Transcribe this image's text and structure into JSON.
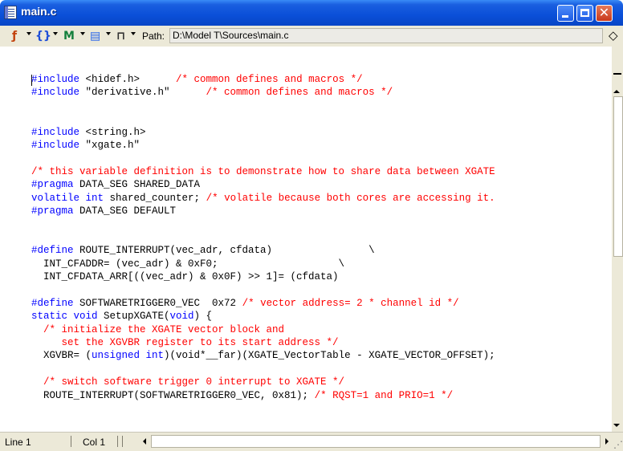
{
  "window": {
    "title": "main.c"
  },
  "toolbar": {
    "path_label": "Path:",
    "path_value": "D:\\Model T\\Sources\\main.c",
    "icons": [
      "function-icon",
      "braces-icon",
      "marker-icon",
      "document-icon",
      "lock-icon"
    ]
  },
  "code_lines": [
    {
      "row": 0,
      "segments": [
        {
          "cls": "pp",
          "text": "#include "
        },
        {
          "cls": "tx",
          "text": "<hidef.h>      "
        },
        {
          "cls": "cm",
          "text": "/* common defines and macros */"
        }
      ]
    },
    {
      "row": 1,
      "segments": [
        {
          "cls": "pp",
          "text": "#include "
        },
        {
          "cls": "tx",
          "text": "\"derivative.h\"      "
        },
        {
          "cls": "cm",
          "text": "/* common defines and macros */"
        }
      ]
    },
    {
      "row": 4,
      "segments": [
        {
          "cls": "pp",
          "text": "#include "
        },
        {
          "cls": "tx",
          "text": "<string.h>"
        }
      ]
    },
    {
      "row": 5,
      "segments": [
        {
          "cls": "pp",
          "text": "#include "
        },
        {
          "cls": "tx",
          "text": "\"xgate.h\""
        }
      ]
    },
    {
      "row": 7,
      "segments": [
        {
          "cls": "cm",
          "text": "/* this variable definition is to demonstrate how to share data between XGATE"
        }
      ]
    },
    {
      "row": 8,
      "segments": [
        {
          "cls": "pp",
          "text": "#pragma "
        },
        {
          "cls": "tx",
          "text": "DATA_SEG SHARED_DATA"
        }
      ]
    },
    {
      "row": 9,
      "segments": [
        {
          "cls": "kw",
          "text": "volatile int "
        },
        {
          "cls": "tx",
          "text": "shared_counter; "
        },
        {
          "cls": "cm",
          "text": "/* volatile because both cores are accessing it."
        }
      ]
    },
    {
      "row": 10,
      "segments": [
        {
          "cls": "pp",
          "text": "#pragma "
        },
        {
          "cls": "tx",
          "text": "DATA_SEG DEFAULT"
        }
      ]
    },
    {
      "row": 13,
      "segments": [
        {
          "cls": "pp",
          "text": "#define "
        },
        {
          "cls": "tx",
          "text": "ROUTE_INTERRUPT(vec_adr, cfdata)                \\"
        }
      ]
    },
    {
      "row": 14,
      "segments": [
        {
          "cls": "tx",
          "text": "  INT_CFADDR= (vec_adr) & 0xF0;                    \\"
        }
      ]
    },
    {
      "row": 15,
      "segments": [
        {
          "cls": "tx",
          "text": "  INT_CFDATA_ARR[((vec_adr) & 0x0F) >> 1]= (cfdata)"
        }
      ]
    },
    {
      "row": 17,
      "segments": [
        {
          "cls": "pp",
          "text": "#define "
        },
        {
          "cls": "tx",
          "text": "SOFTWARETRIGGER0_VEC  0x72 "
        },
        {
          "cls": "cm",
          "text": "/* vector address= 2 * channel id */"
        }
      ]
    },
    {
      "row": 18,
      "segments": [
        {
          "cls": "kw",
          "text": "static void "
        },
        {
          "cls": "tx",
          "text": "SetupXGATE("
        },
        {
          "cls": "kw",
          "text": "void"
        },
        {
          "cls": "tx",
          "text": ") {"
        }
      ]
    },
    {
      "row": 19,
      "segments": [
        {
          "cls": "cm",
          "text": "  /* initialize the XGATE vector block and"
        }
      ]
    },
    {
      "row": 20,
      "segments": [
        {
          "cls": "cm",
          "text": "     set the XGVBR register to its start address */"
        }
      ]
    },
    {
      "row": 21,
      "segments": [
        {
          "cls": "tx",
          "text": "  XGVBR= ("
        },
        {
          "cls": "kw",
          "text": "unsigned int"
        },
        {
          "cls": "tx",
          "text": ")(void*__far)(XGATE_VectorTable - XGATE_VECTOR_OFFSET);"
        }
      ]
    },
    {
      "row": 23,
      "segments": [
        {
          "cls": "cm",
          "text": "  /* switch software trigger 0 interrupt to XGATE */"
        }
      ]
    },
    {
      "row": 24,
      "segments": [
        {
          "cls": "tx",
          "text": "  ROUTE_INTERRUPT(SOFTWARETRIGGER0_VEC, 0x81); "
        },
        {
          "cls": "cm",
          "text": "/* RQST=1 and PRIO=1 */"
        }
      ]
    }
  ],
  "status": {
    "line": "Line 1",
    "col": "Col 1"
  }
}
